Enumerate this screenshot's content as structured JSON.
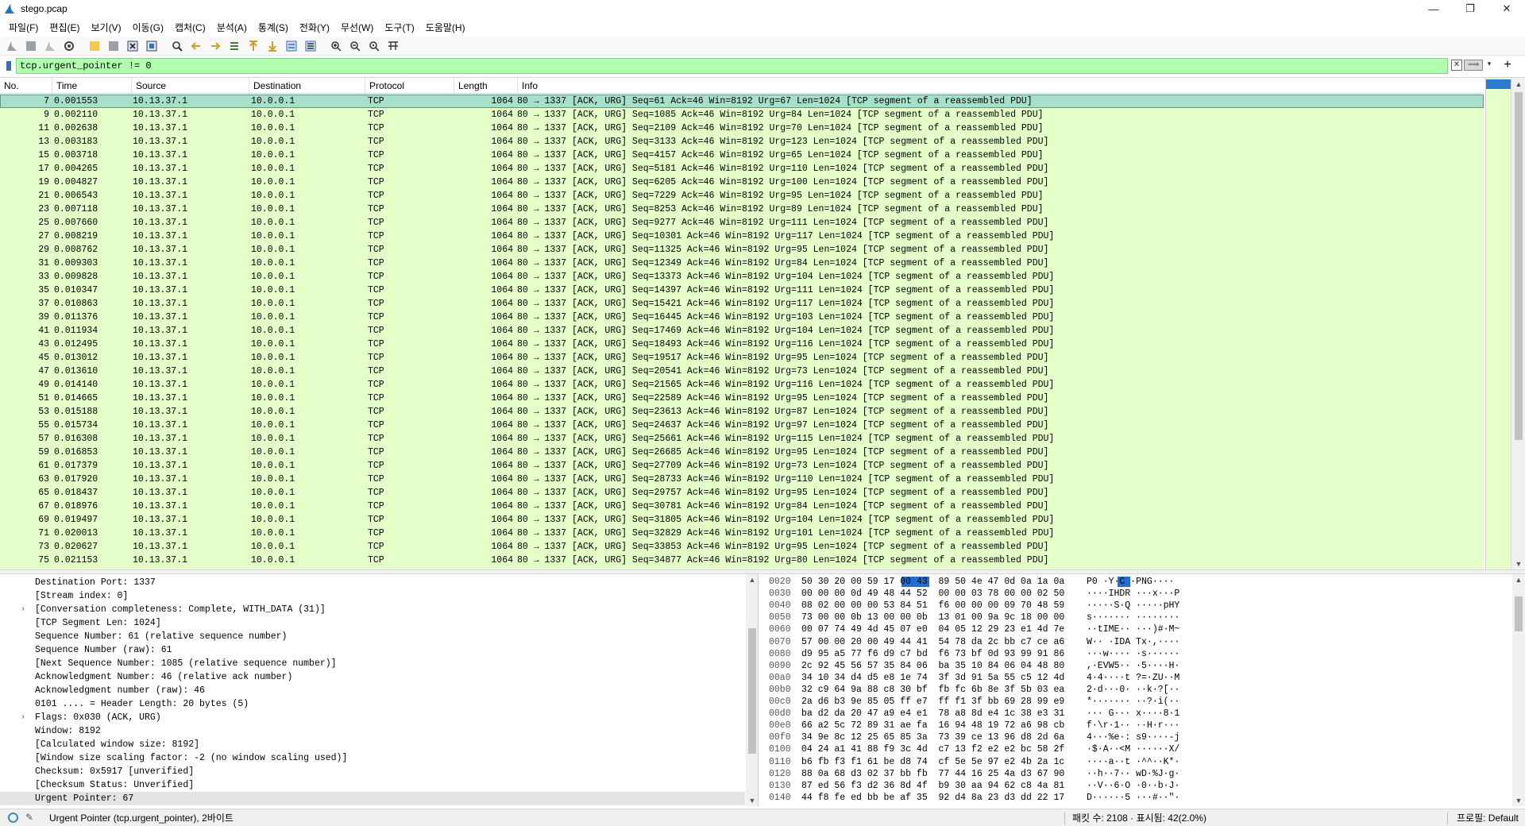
{
  "window": {
    "title": "stego.pcap",
    "minimize": "—",
    "maximize": "❐",
    "close": "✕"
  },
  "menu": [
    "파일(F)",
    "편집(E)",
    "보기(V)",
    "이동(G)",
    "캡처(C)",
    "분석(A)",
    "통계(S)",
    "전화(Y)",
    "무선(W)",
    "도구(T)",
    "도움말(H)"
  ],
  "filter": {
    "value": "tcp.urgent_pointer != 0",
    "clear_label": "✕",
    "apply_label": "⟹",
    "dropdown_label": "▾",
    "add_label": "+"
  },
  "colors": {
    "row_bg": "#e4ffc7",
    "row_selected": "#a6e0c8",
    "filter_bg": "#afffaf",
    "byte_highlight": "#1f6fd6"
  },
  "packet_list": {
    "columns": [
      "No.",
      "Time",
      "Source",
      "Destination",
      "Protocol",
      "Length",
      "Info"
    ],
    "source": "10.13.37.1",
    "destination": "10.0.0.1",
    "protocol": "TCP",
    "length": "1064",
    "rows": [
      {
        "no": "7",
        "time": "0.001553",
        "info": "80 → 1337 [ACK, URG] Seq=61 Ack=46 Win=8192 Urg=67 Len=1024 [TCP segment of a reassembled PDU]"
      },
      {
        "no": "9",
        "time": "0.002110",
        "info": "80 → 1337 [ACK, URG] Seq=1085 Ack=46 Win=8192 Urg=84 Len=1024 [TCP segment of a reassembled PDU]"
      },
      {
        "no": "11",
        "time": "0.002638",
        "info": "80 → 1337 [ACK, URG] Seq=2109 Ack=46 Win=8192 Urg=70 Len=1024 [TCP segment of a reassembled PDU]"
      },
      {
        "no": "13",
        "time": "0.003183",
        "info": "80 → 1337 [ACK, URG] Seq=3133 Ack=46 Win=8192 Urg=123 Len=1024 [TCP segment of a reassembled PDU]"
      },
      {
        "no": "15",
        "time": "0.003718",
        "info": "80 → 1337 [ACK, URG] Seq=4157 Ack=46 Win=8192 Urg=65 Len=1024 [TCP segment of a reassembled PDU]"
      },
      {
        "no": "17",
        "time": "0.004265",
        "info": "80 → 1337 [ACK, URG] Seq=5181 Ack=46 Win=8192 Urg=110 Len=1024 [TCP segment of a reassembled PDU]"
      },
      {
        "no": "19",
        "time": "0.004827",
        "info": "80 → 1337 [ACK, URG] Seq=6205 Ack=46 Win=8192 Urg=100 Len=1024 [TCP segment of a reassembled PDU]"
      },
      {
        "no": "21",
        "time": "0.006543",
        "info": "80 → 1337 [ACK, URG] Seq=7229 Ack=46 Win=8192 Urg=95 Len=1024 [TCP segment of a reassembled PDU]"
      },
      {
        "no": "23",
        "time": "0.007118",
        "info": "80 → 1337 [ACK, URG] Seq=8253 Ack=46 Win=8192 Urg=89 Len=1024 [TCP segment of a reassembled PDU]"
      },
      {
        "no": "25",
        "time": "0.007660",
        "info": "80 → 1337 [ACK, URG] Seq=9277 Ack=46 Win=8192 Urg=111 Len=1024 [TCP segment of a reassembled PDU]"
      },
      {
        "no": "27",
        "time": "0.008219",
        "info": "80 → 1337 [ACK, URG] Seq=10301 Ack=46 Win=8192 Urg=117 Len=1024 [TCP segment of a reassembled PDU]"
      },
      {
        "no": "29",
        "time": "0.008762",
        "info": "80 → 1337 [ACK, URG] Seq=11325 Ack=46 Win=8192 Urg=95 Len=1024 [TCP segment of a reassembled PDU]"
      },
      {
        "no": "31",
        "time": "0.009303",
        "info": "80 → 1337 [ACK, URG] Seq=12349 Ack=46 Win=8192 Urg=84 Len=1024 [TCP segment of a reassembled PDU]"
      },
      {
        "no": "33",
        "time": "0.009828",
        "info": "80 → 1337 [ACK, URG] Seq=13373 Ack=46 Win=8192 Urg=104 Len=1024 [TCP segment of a reassembled PDU]"
      },
      {
        "no": "35",
        "time": "0.010347",
        "info": "80 → 1337 [ACK, URG] Seq=14397 Ack=46 Win=8192 Urg=111 Len=1024 [TCP segment of a reassembled PDU]"
      },
      {
        "no": "37",
        "time": "0.010863",
        "info": "80 → 1337 [ACK, URG] Seq=15421 Ack=46 Win=8192 Urg=117 Len=1024 [TCP segment of a reassembled PDU]"
      },
      {
        "no": "39",
        "time": "0.011376",
        "info": "80 → 1337 [ACK, URG] Seq=16445 Ack=46 Win=8192 Urg=103 Len=1024 [TCP segment of a reassembled PDU]"
      },
      {
        "no": "41",
        "time": "0.011934",
        "info": "80 → 1337 [ACK, URG] Seq=17469 Ack=46 Win=8192 Urg=104 Len=1024 [TCP segment of a reassembled PDU]"
      },
      {
        "no": "43",
        "time": "0.012495",
        "info": "80 → 1337 [ACK, URG] Seq=18493 Ack=46 Win=8192 Urg=116 Len=1024 [TCP segment of a reassembled PDU]"
      },
      {
        "no": "45",
        "time": "0.013012",
        "info": "80 → 1337 [ACK, URG] Seq=19517 Ack=46 Win=8192 Urg=95 Len=1024 [TCP segment of a reassembled PDU]"
      },
      {
        "no": "47",
        "time": "0.013610",
        "info": "80 → 1337 [ACK, URG] Seq=20541 Ack=46 Win=8192 Urg=73 Len=1024 [TCP segment of a reassembled PDU]"
      },
      {
        "no": "49",
        "time": "0.014140",
        "info": "80 → 1337 [ACK, URG] Seq=21565 Ack=46 Win=8192 Urg=116 Len=1024 [TCP segment of a reassembled PDU]"
      },
      {
        "no": "51",
        "time": "0.014665",
        "info": "80 → 1337 [ACK, URG] Seq=22589 Ack=46 Win=8192 Urg=95 Len=1024 [TCP segment of a reassembled PDU]"
      },
      {
        "no": "53",
        "time": "0.015188",
        "info": "80 → 1337 [ACK, URG] Seq=23613 Ack=46 Win=8192 Urg=87 Len=1024 [TCP segment of a reassembled PDU]"
      },
      {
        "no": "55",
        "time": "0.015734",
        "info": "80 → 1337 [ACK, URG] Seq=24637 Ack=46 Win=8192 Urg=97 Len=1024 [TCP segment of a reassembled PDU]"
      },
      {
        "no": "57",
        "time": "0.016308",
        "info": "80 → 1337 [ACK, URG] Seq=25661 Ack=46 Win=8192 Urg=115 Len=1024 [TCP segment of a reassembled PDU]"
      },
      {
        "no": "59",
        "time": "0.016853",
        "info": "80 → 1337 [ACK, URG] Seq=26685 Ack=46 Win=8192 Urg=95 Len=1024 [TCP segment of a reassembled PDU]"
      },
      {
        "no": "61",
        "time": "0.017379",
        "info": "80 → 1337 [ACK, URG] Seq=27709 Ack=46 Win=8192 Urg=73 Len=1024 [TCP segment of a reassembled PDU]"
      },
      {
        "no": "63",
        "time": "0.017920",
        "info": "80 → 1337 [ACK, URG] Seq=28733 Ack=46 Win=8192 Urg=110 Len=1024 [TCP segment of a reassembled PDU]"
      },
      {
        "no": "65",
        "time": "0.018437",
        "info": "80 → 1337 [ACK, URG] Seq=29757 Ack=46 Win=8192 Urg=95 Len=1024 [TCP segment of a reassembled PDU]"
      },
      {
        "no": "67",
        "time": "0.018976",
        "info": "80 → 1337 [ACK, URG] Seq=30781 Ack=46 Win=8192 Urg=84 Len=1024 [TCP segment of a reassembled PDU]"
      },
      {
        "no": "69",
        "time": "0.019497",
        "info": "80 → 1337 [ACK, URG] Seq=31805 Ack=46 Win=8192 Urg=104 Len=1024 [TCP segment of a reassembled PDU]"
      },
      {
        "no": "71",
        "time": "0.020013",
        "info": "80 → 1337 [ACK, URG] Seq=32829 Ack=46 Win=8192 Urg=101 Len=1024 [TCP segment of a reassembled PDU]"
      },
      {
        "no": "73",
        "time": "0.020627",
        "info": "80 → 1337 [ACK, URG] Seq=33853 Ack=46 Win=8192 Urg=95 Len=1024 [TCP segment of a reassembled PDU]"
      },
      {
        "no": "75",
        "time": "0.021153",
        "info": "80 → 1337 [ACK, URG] Seq=34877 Ack=46 Win=8192 Urg=80 Len=1024 [TCP segment of a reassembled PDU]"
      }
    ]
  },
  "details": {
    "rows": [
      {
        "text": "Destination Port: 1337",
        "expander": ""
      },
      {
        "text": "[Stream index: 0]",
        "expander": ""
      },
      {
        "text": "[Conversation completeness: Complete, WITH_DATA (31)]",
        "expander": "›"
      },
      {
        "text": "[TCP Segment Len: 1024]",
        "expander": ""
      },
      {
        "text": "Sequence Number: 61    (relative sequence number)",
        "expander": ""
      },
      {
        "text": "Sequence Number (raw): 61",
        "expander": ""
      },
      {
        "text": "[Next Sequence Number: 1085    (relative sequence number)]",
        "expander": ""
      },
      {
        "text": "Acknowledgment Number: 46    (relative ack number)",
        "expander": ""
      },
      {
        "text": "Acknowledgment number (raw): 46",
        "expander": ""
      },
      {
        "text": "0101 .... = Header Length: 20 bytes (5)",
        "expander": ""
      },
      {
        "text": "Flags: 0x030 (ACK, URG)",
        "expander": "›"
      },
      {
        "text": "Window: 8192",
        "expander": ""
      },
      {
        "text": "[Calculated window size: 8192]",
        "expander": ""
      },
      {
        "text": "[Window size scaling factor: -2 (no window scaling used)]",
        "expander": ""
      },
      {
        "text": "Checksum: 0x5917 [unverified]",
        "expander": ""
      },
      {
        "text": "[Checksum Status: Unverified]",
        "expander": ""
      },
      {
        "text": "Urgent Pointer: 67",
        "expander": "",
        "highlight": true
      }
    ]
  },
  "bytes": {
    "rows": [
      {
        "off": "0020",
        "hex": "50 30 20 00 59 17 00 43  89 50 4e 47 0d 0a 1a 0a",
        "asc": "P0 ·Y·C ·PNG····",
        "sel": true
      },
      {
        "off": "0030",
        "hex": "00 00 00 0d 49 48 44 52  00 00 03 78 00 00 02 50",
        "asc": "····IHDR ···x···P"
      },
      {
        "off": "0040",
        "hex": "08 02 00 00 00 53 84 51  f6 00 00 00 09 70 48 59",
        "asc": "·····S·Q ·····pHY"
      },
      {
        "off": "0050",
        "hex": "73 00 00 0b 13 00 00 0b  13 01 00 9a 9c 18 00 00",
        "asc": "s······· ········"
      },
      {
        "off": "0060",
        "hex": "00 07 74 49 4d 45 07 e0  04 05 12 29 23 e1 4d 7e",
        "asc": "··tIME·· ···)#·M~"
      },
      {
        "off": "0070",
        "hex": "57 00 00 20 00 49 44 41  54 78 da 2c bb c7 ce a6",
        "asc": "W·· ·IDA Tx·,····"
      },
      {
        "off": "0080",
        "hex": "d9 95 a5 77 f6 d9 c7 bd  f6 73 bf 0d 93 99 91 86",
        "asc": "···w···· ·s······"
      },
      {
        "off": "0090",
        "hex": "2c 92 45 56 57 35 84 06  ba 35 10 84 06 04 48 80",
        "asc": ",·EVW5·· ·5····H·"
      },
      {
        "off": "00a0",
        "hex": "34 10 34 d4 d5 e8 1e 74  3f 3d 91 5a 55 c5 12 4d",
        "asc": "4·4····t ?=·ZU··M"
      },
      {
        "off": "00b0",
        "hex": "32 c9 64 9a 88 c8 30 bf  fb fc 6b 8e 3f 5b 03 ea",
        "asc": "2·d···0· ··k·?[··"
      },
      {
        "off": "00c0",
        "hex": "2a d6 b3 9e 85 05 ff e7  ff f1 3f bb 69 28 99 e9",
        "asc": "*······· ··?·i(··"
      },
      {
        "off": "00d0",
        "hex": "ba d2 da 20 47 a9 e4 e1  78 a8 8d e4 1c 38 e3 31",
        "asc": "··· G··· x····8·1"
      },
      {
        "off": "00e0",
        "hex": "66 a2 5c 72 89 31 ae fa  16 94 48 19 72 a6 98 cb",
        "asc": "f·\\r·1·· ··H·r···"
      },
      {
        "off": "00f0",
        "hex": "34 9e 8c 12 25 65 85 3a  73 39 ce 13 96 d8 2d 6a",
        "asc": "4···%e·: s9····-j"
      },
      {
        "off": "0100",
        "hex": "04 24 a1 41 88 f9 3c 4d  c7 13 f2 e2 e2 bc 58 2f",
        "asc": "·$·A··<M ······X/"
      },
      {
        "off": "0110",
        "hex": "b6 fb f3 f1 61 be d8 74  cf 5e 5e 97 e2 4b 2a 1c",
        "asc": "····a··t ·^^··K*·"
      },
      {
        "off": "0120",
        "hex": "88 0a 68 d3 02 37 bb fb  77 44 16 25 4a d3 67 90",
        "asc": "··h··7·· wD·%J·g·"
      },
      {
        "off": "0130",
        "hex": "87 ed 56 f3 d2 36 8d 4f  b9 30 aa 94 62 c8 4a 81",
        "asc": "··V··6·O ·0··b·J·"
      },
      {
        "off": "0140",
        "hex": "44 f8 fe ed bb be af 35  92 d4 8a 23 d3 dd 22 17",
        "asc": "D······5 ···#··\"·"
      }
    ]
  },
  "status": {
    "field": "Urgent Pointer (tcp.urgent_pointer), 2바이트",
    "packets": "패킷 수: 2108 · 표시됨: 42(2.0%)",
    "profile": "프로필: Default"
  }
}
